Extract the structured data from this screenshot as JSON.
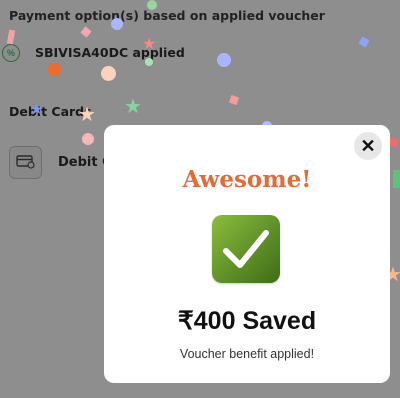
{
  "background": {
    "header": "Payment option(s) based on applied voucher",
    "voucher_applied": "SBIVISA40DC applied",
    "section_label": "Debit Cards",
    "card_label": "Debit C"
  },
  "modal": {
    "title": "Awesome!",
    "saved": "₹400 Saved",
    "subtitle": "Voucher benefit applied!",
    "close_symbol": "✕"
  },
  "colors": {
    "title": "#e46a36",
    "check_bg": "#6a9a2f",
    "overlay": "#8e8e8e"
  }
}
